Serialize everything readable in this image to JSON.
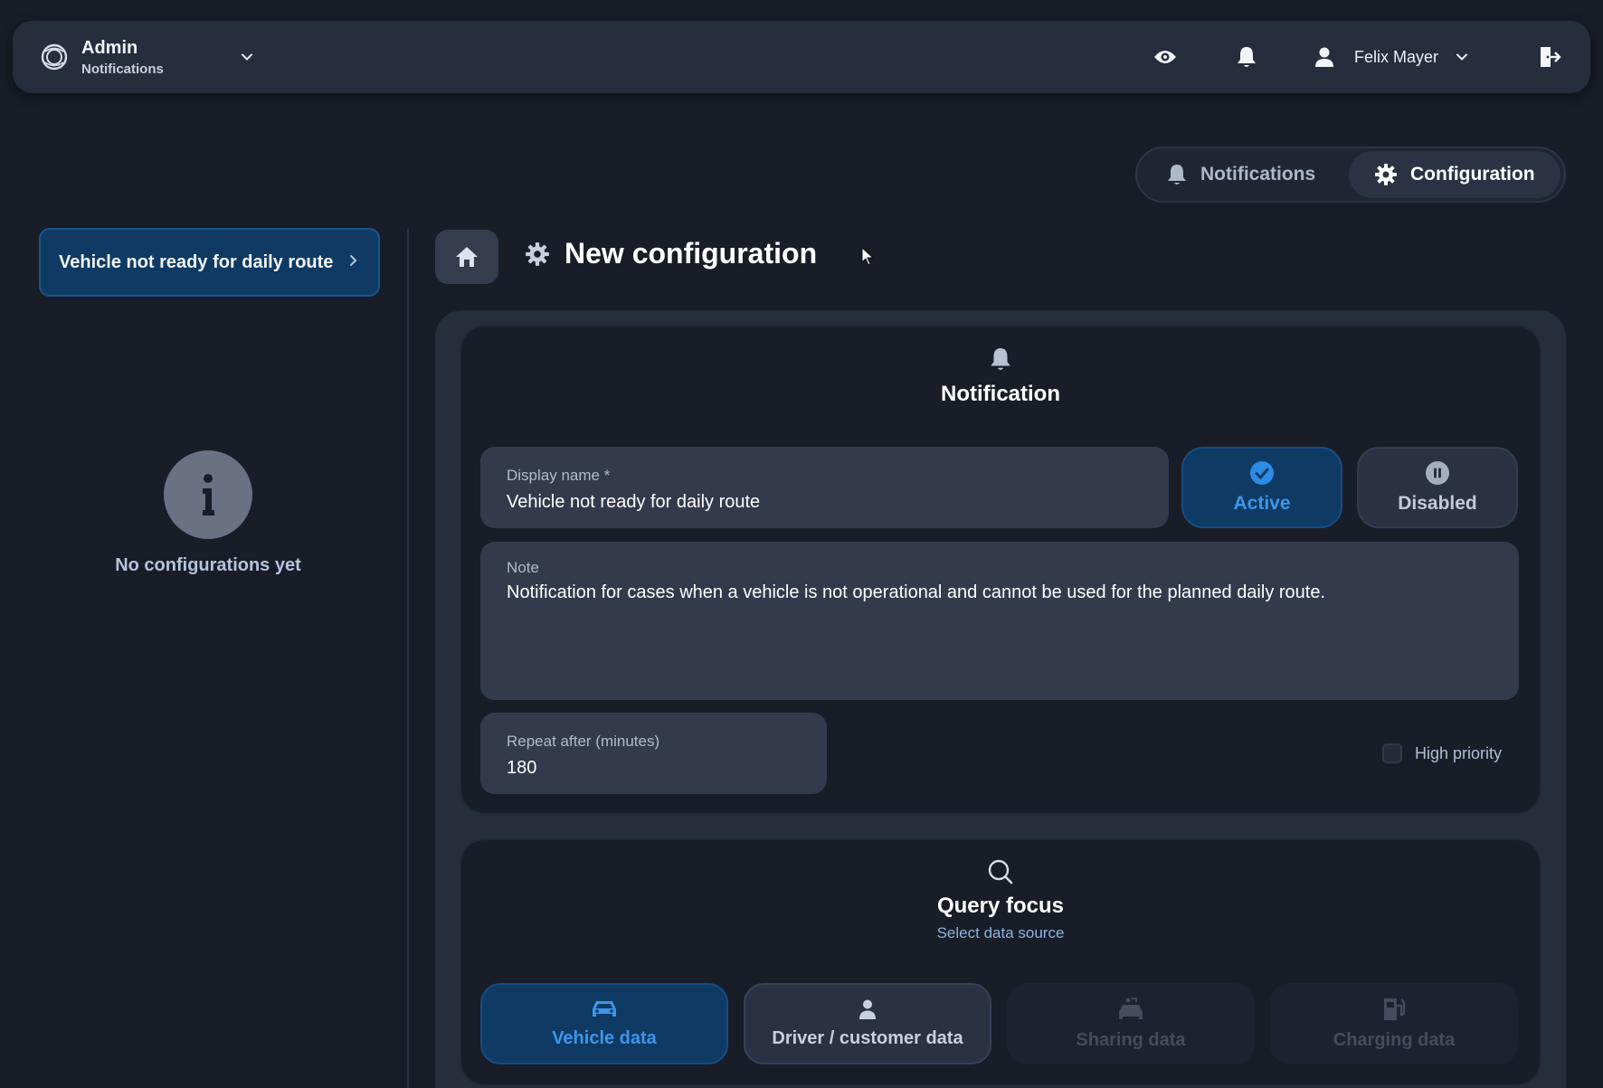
{
  "topbar": {
    "app_title": "Admin",
    "app_subtitle": "Notifications",
    "user_name": "Felix Mayer"
  },
  "mode_toggle": {
    "notifications_label": "Notifications",
    "configuration_label": "Configuration",
    "selected": "Configuration"
  },
  "sidebar": {
    "items": [
      {
        "label": "Vehicle not ready for daily route"
      }
    ],
    "empty_text": "No configurations yet"
  },
  "page": {
    "title": "New configuration"
  },
  "notification_card": {
    "title": "Notification",
    "display_name": {
      "label": "Display name *",
      "value": "Vehicle not ready for daily route"
    },
    "status": {
      "active_label": "Active",
      "disabled_label": "Disabled",
      "selected": "Active"
    },
    "note": {
      "label": "Note",
      "value": "Notification for cases when a vehicle is not operational and cannot be used for the planned daily route."
    },
    "repeat": {
      "label": "Repeat after (minutes)",
      "value": "180"
    },
    "high_priority": {
      "label": "High priority",
      "checked": false
    }
  },
  "query_card": {
    "title": "Query focus",
    "subtitle": "Select data source",
    "sources": [
      {
        "label": "Vehicle data",
        "icon": "car-icon",
        "state": "selected"
      },
      {
        "label": "Driver / customer data",
        "icon": "person-icon",
        "state": "enabled"
      },
      {
        "label": "Sharing data",
        "icon": "car-share-icon",
        "state": "disabled"
      },
      {
        "label": "Charging data",
        "icon": "charging-icon",
        "state": "disabled"
      }
    ]
  },
  "colors": {
    "background": "#181d27",
    "accent": "#3d96ea",
    "selected_fill": "#0f3a63"
  }
}
